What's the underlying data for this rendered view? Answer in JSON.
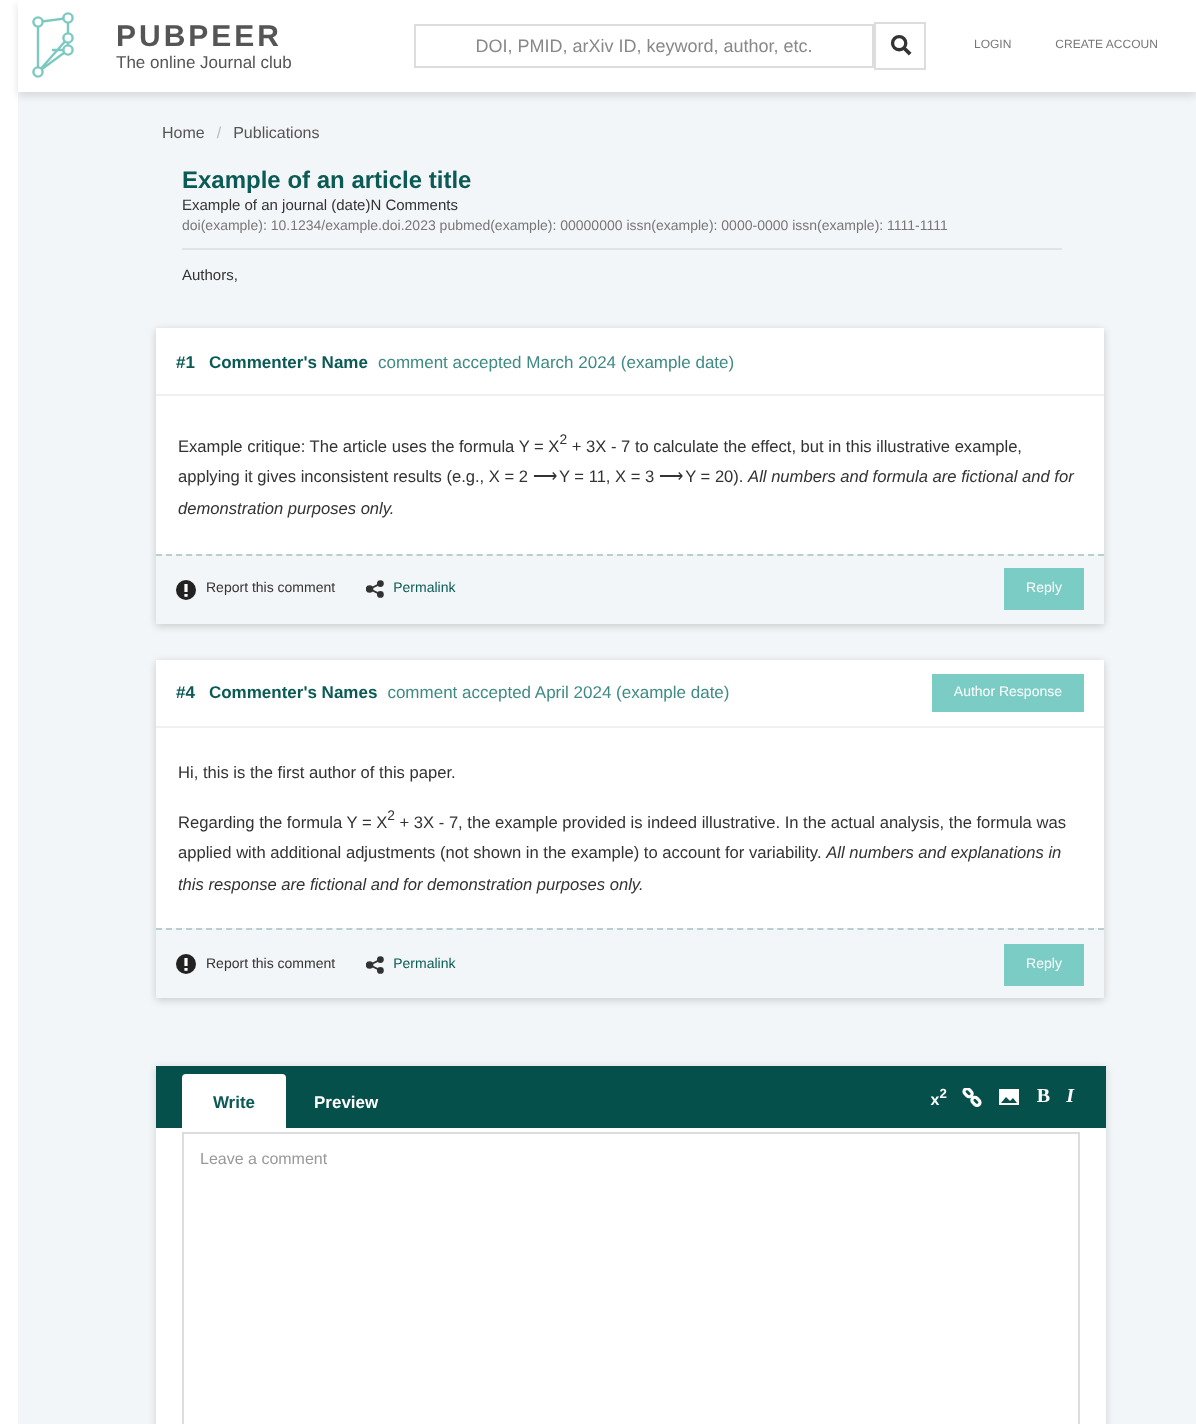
{
  "header": {
    "logo": "PUBPEER",
    "tagline": "The online Journal club",
    "search": {
      "placeholder": "DOI, PMID, arXiv ID, keyword, author, etc."
    },
    "nav": [
      "LOGIN",
      "CREATE ACCOUN"
    ]
  },
  "breadcrumbs": [
    "Home",
    "Publications"
  ],
  "breadcrumb_separator": "/",
  "article": {
    "title": "Example of an article title",
    "journal": "Example of an journal (date)N Comments",
    "ids": "doi(example): 10.1234/example.doi.2023 pubmed(example): 00000000 issn(example): 0000-0000 issn(example): 1111-1111",
    "authors": "Authors,"
  },
  "comments": [
    {
      "number": "#1",
      "name": "Commenter's Name",
      "accepted": "comment accepted March 2024 (example date)",
      "paragraphs": [
        "Example critique: The article uses the formula Y = X$^{2}$ + 3X - 7 to calculate the effect, but in this illustrative example, applying it gives inconsistent results (e.g., X = 2 ⟶ Y = 11, X = 3 ⟶ Y = 20). *All numbers and formula are fictional and for demonstration purposes only.*"
      ],
      "report": "Report this comment",
      "permalink": "Permalink",
      "reply": "Reply"
    },
    {
      "number": "#4",
      "name": "Commenter's Names",
      "accepted": "comment accepted April 2024 (example date)",
      "badge": "Author Response",
      "paragraphs": [
        "Hi, this is the first author of this paper.",
        "Regarding the formula Y = X$^{2}$ + 3X - 7, the example provided is indeed illustrative. In the actual analysis, the formula was applied with additional adjustments (not shown in the example) to account for variability. *All numbers and explanations in this response are fictional and for demonstration purposes only.*"
      ],
      "report": "Report this comment",
      "permalink": "Permalink",
      "reply": "Reply"
    }
  ],
  "editor": {
    "tabs": [
      {
        "label": "Write",
        "selected": true
      },
      {
        "label": "Preview",
        "selected": false
      }
    ],
    "toolbar": [
      {
        "kind": "text",
        "label": "x$^{2}$"
      },
      {
        "kind": "link"
      },
      {
        "kind": "image"
      },
      {
        "kind": "bold",
        "label": "B"
      },
      {
        "kind": "italic",
        "label": "I"
      }
    ],
    "placeholder": "Leave a comment"
  }
}
